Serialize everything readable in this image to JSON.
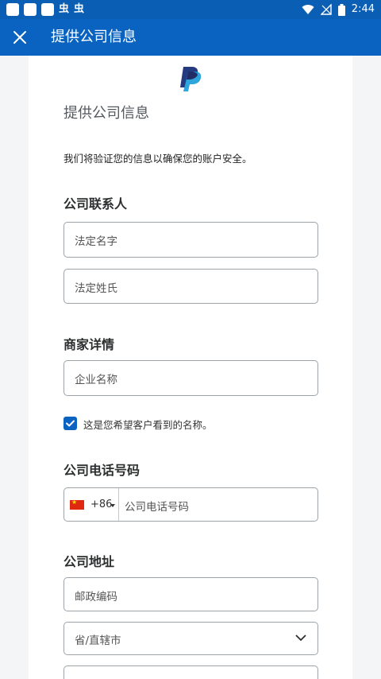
{
  "status_bar": {
    "notif_icons": [
      "square-icon",
      "square-icon",
      "square-icon"
    ],
    "bug_icons": [
      "虫",
      "虫"
    ],
    "time": "2:44"
  },
  "app_bar": {
    "title": "提供公司信息"
  },
  "form": {
    "heading": "提供公司信息",
    "description": "我们将验证您的信息以确保您的账户安全。",
    "contact_section": "公司联系人",
    "first_name_placeholder": "法定名字",
    "last_name_placeholder": "法定姓氏",
    "merchant_section": "商家详情",
    "business_name_placeholder": "企业名称",
    "checkbox_label": "这是您希望客户看到的名称。",
    "checkbox_checked": true,
    "phone_section": "公司电话号码",
    "country_code": "+86",
    "phone_placeholder": "公司电话号码",
    "address_section": "公司地址",
    "postal_code_placeholder": "邮政编码",
    "province_placeholder": "省/直辖市"
  },
  "colors": {
    "status_bar": "#0a5fb4",
    "app_bar": "#0b63c1",
    "checkbox": "#0b63c1",
    "page_bg": "#f3f5f7"
  }
}
